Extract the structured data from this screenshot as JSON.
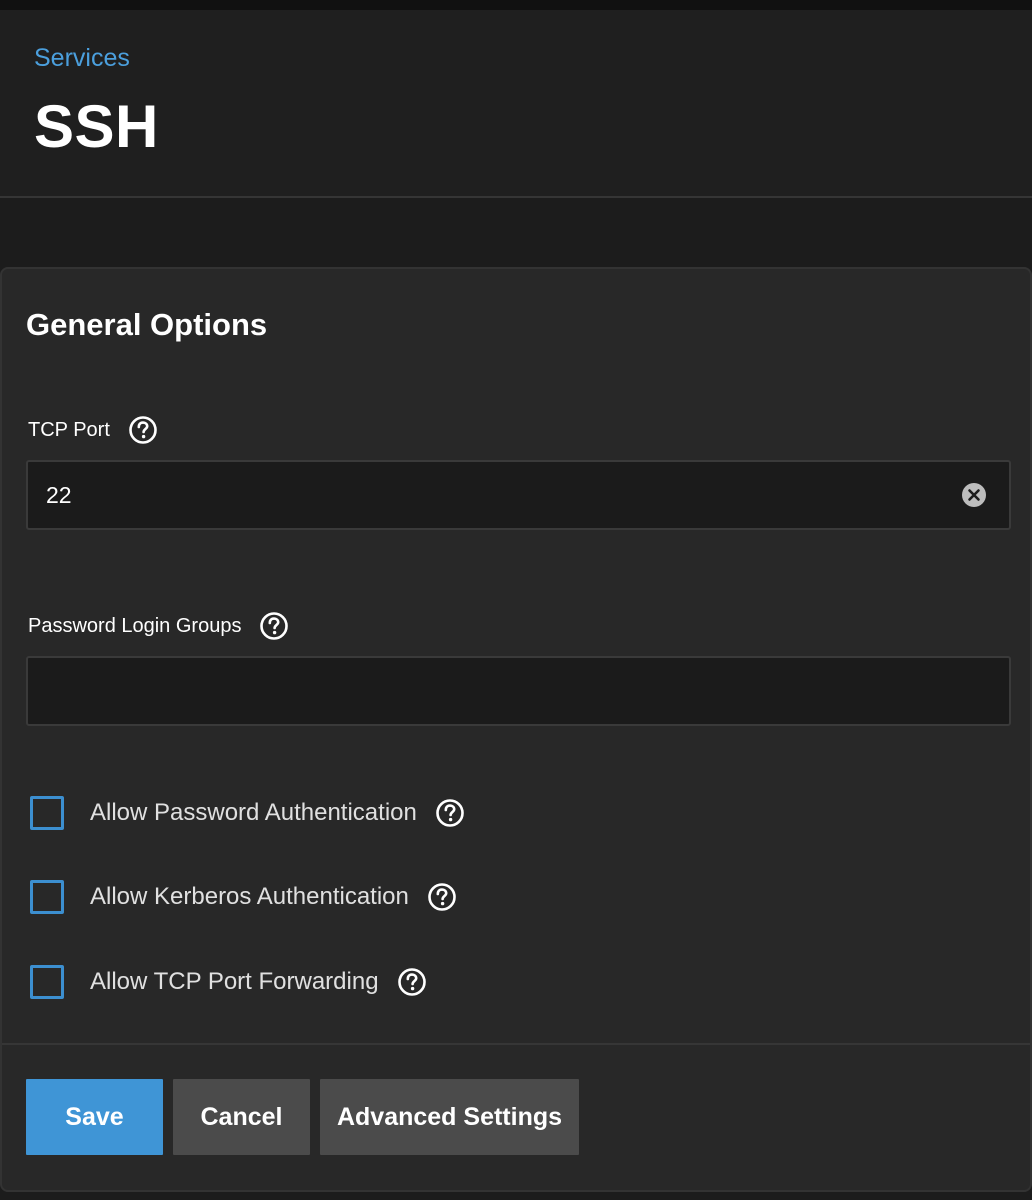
{
  "header": {
    "breadcrumb": "Services",
    "title": "SSH"
  },
  "form": {
    "section_title": "General Options",
    "tcp_port": {
      "label": "TCP Port",
      "value": "22",
      "help_icon": "help-circle-icon",
      "clear_icon": "clear-circle-icon"
    },
    "password_login_groups": {
      "label": "Password Login Groups",
      "value": "",
      "help_icon": "help-circle-icon"
    },
    "checkboxes": [
      {
        "label": "Allow Password Authentication",
        "checked": false
      },
      {
        "label": "Allow Kerberos Authentication",
        "checked": false
      },
      {
        "label": "Allow TCP Port Forwarding",
        "checked": false
      }
    ]
  },
  "actions": {
    "save_label": "Save",
    "cancel_label": "Cancel",
    "advanced_label": "Advanced Settings"
  },
  "colors": {
    "accent": "#3f95d6",
    "link": "#4b9fdd",
    "background": "#1c1c1c",
    "card": "#282828",
    "secondary_button": "#4b4b4b"
  }
}
